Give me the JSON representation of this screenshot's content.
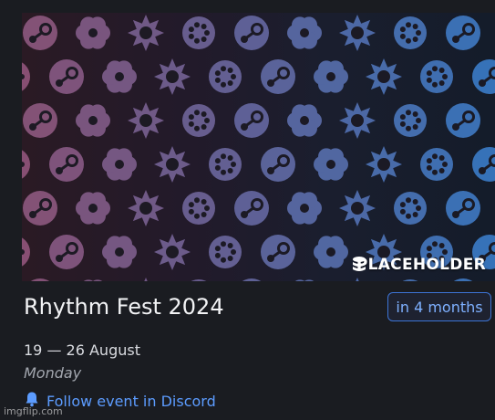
{
  "event": {
    "banner_badge": "PLACEHOLDER",
    "title": "Rhythm Fest 2024",
    "countdown": "in 4 months",
    "dates": "19 — 26 August",
    "weekday": "Monday",
    "follow_label": "Follow event in Discord"
  },
  "watermark": "imgflip.com",
  "colors": {
    "accent": "#5c9cff",
    "badge_border": "#3d74d6",
    "background": "#1a1c21"
  },
  "icons": {
    "badge_icon": "database-icon",
    "follow_icon": "bell-icon"
  }
}
